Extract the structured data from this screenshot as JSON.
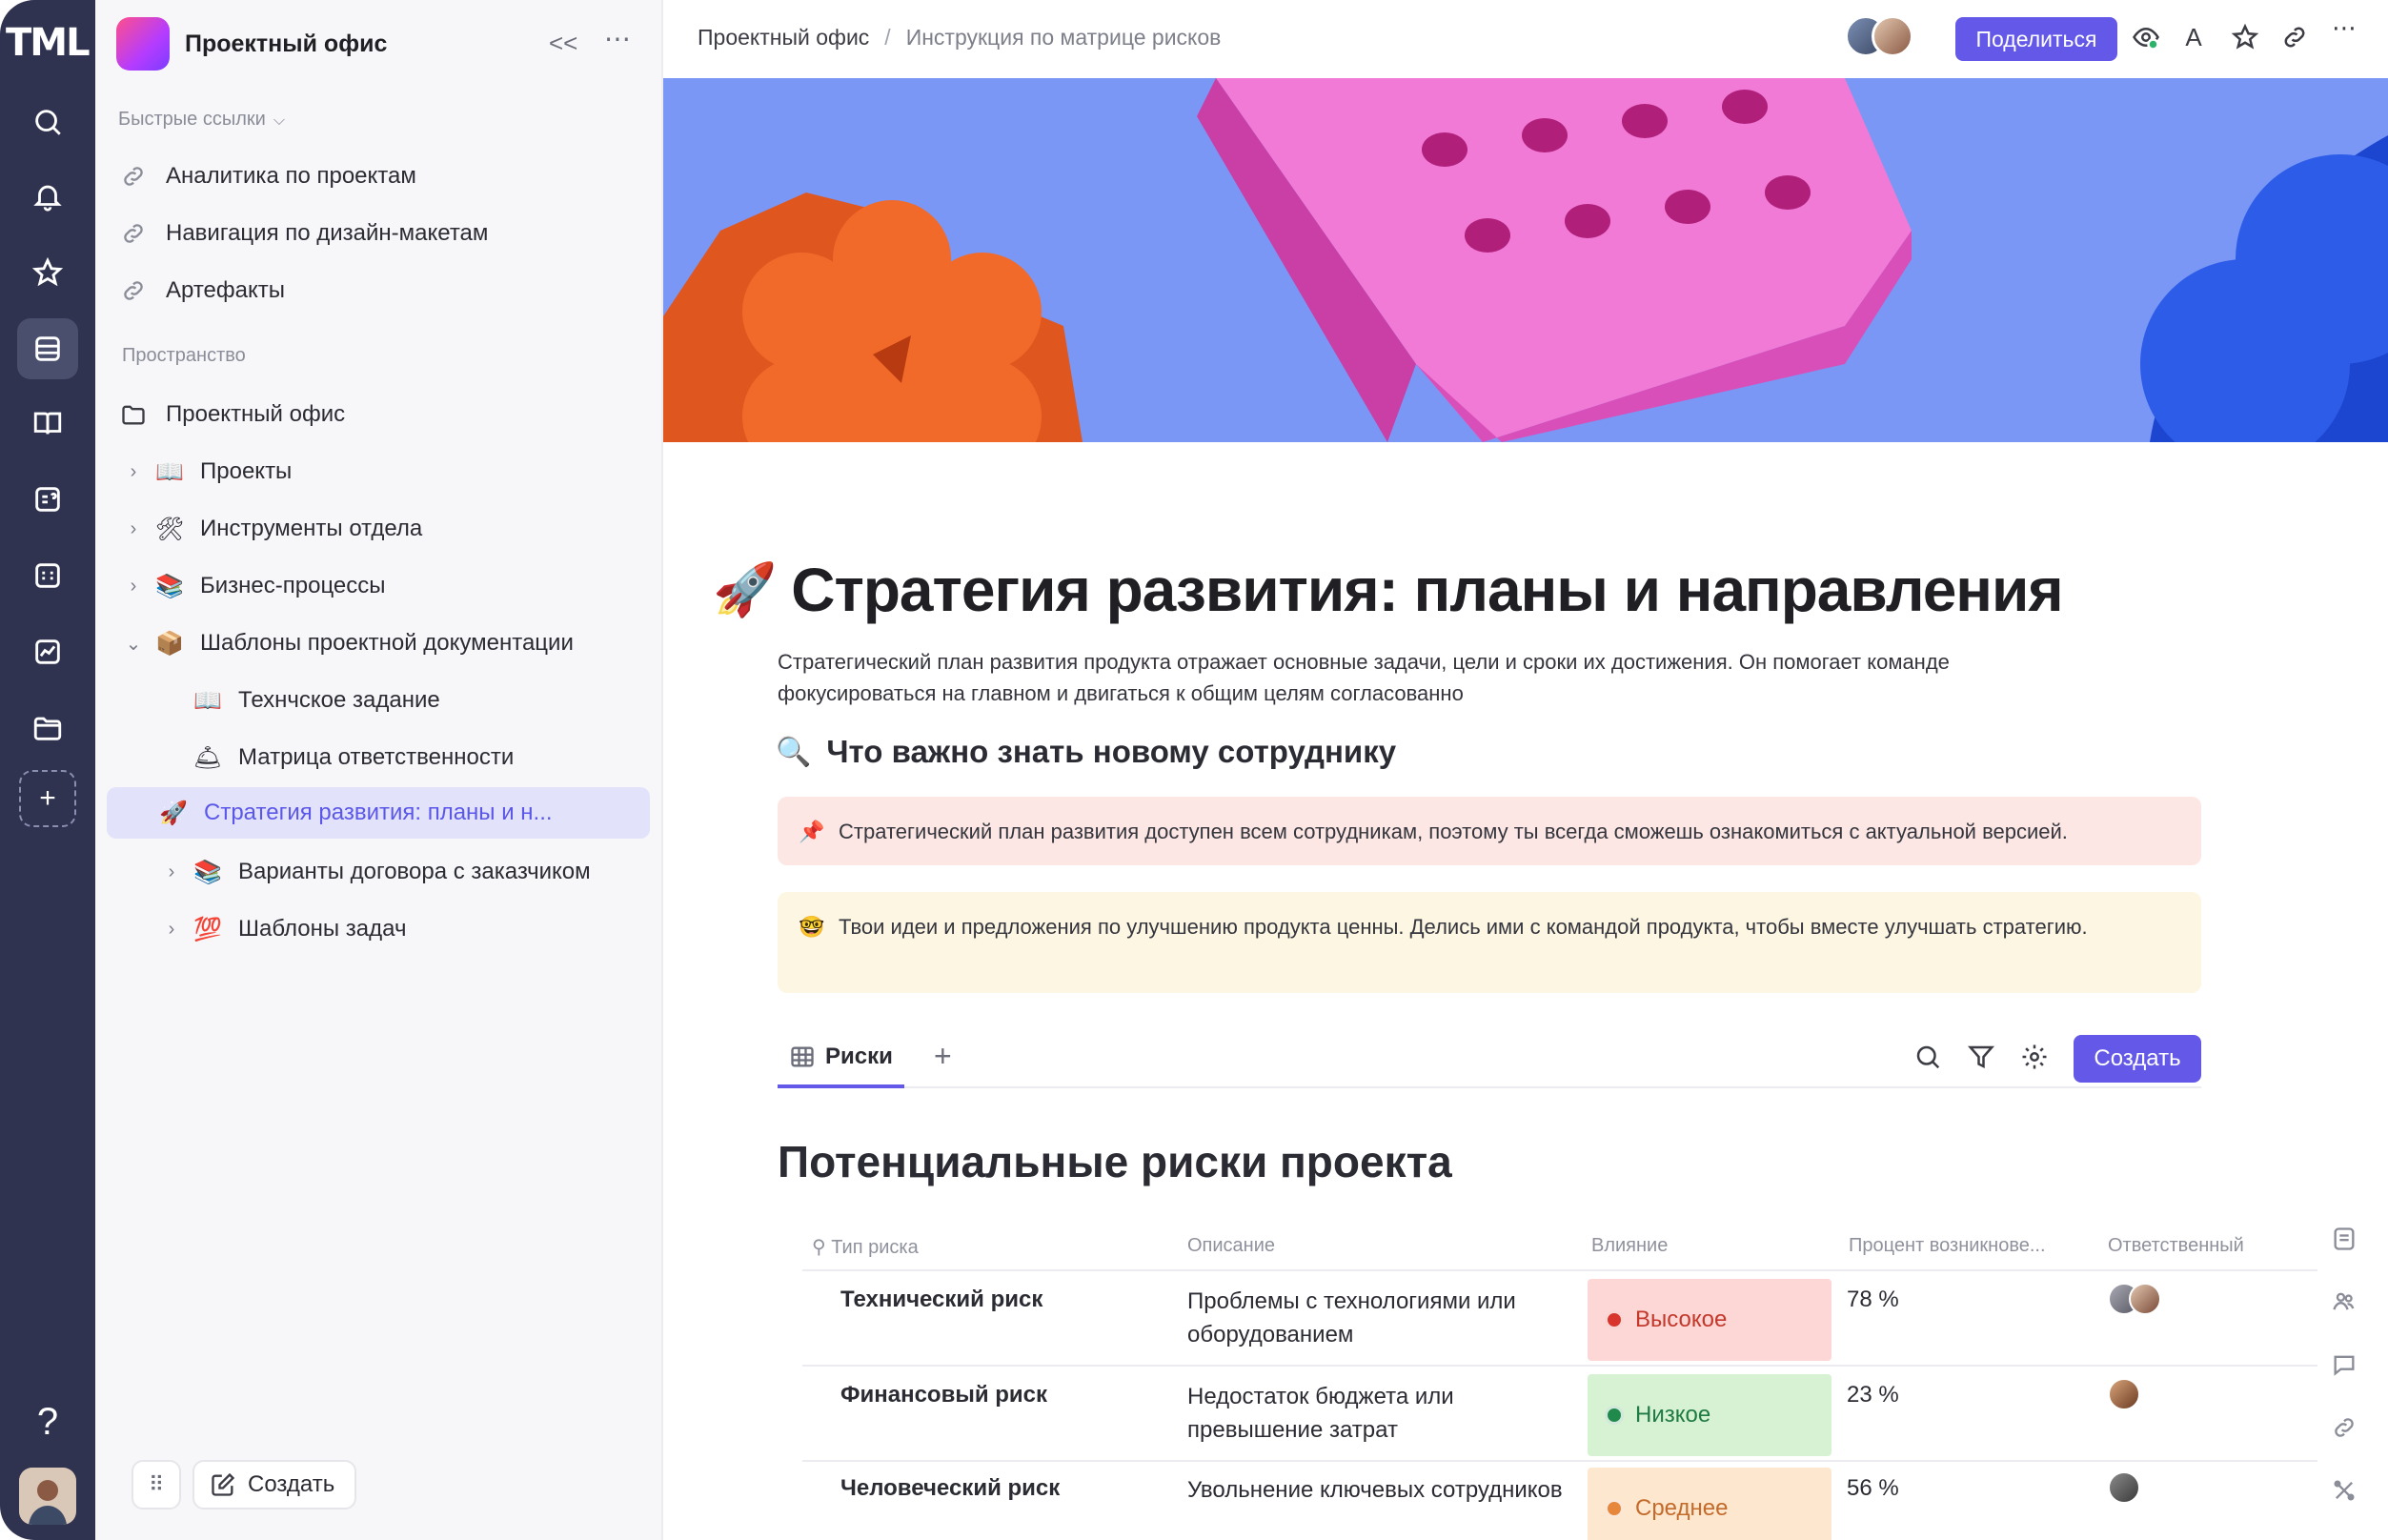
{
  "rail": {
    "logo": "TML",
    "icons": [
      "search-icon",
      "bell-icon",
      "star-icon",
      "docs-icon",
      "book-icon",
      "wiki-icon",
      "table-icon",
      "chart-icon",
      "folder-icon"
    ],
    "add": "+",
    "help": "?"
  },
  "sidebar": {
    "workspace_title": "Проектный офис",
    "collapse": "<<",
    "more": "⋯",
    "quick_links_label": "Быстрые ссылки",
    "quick_links": [
      {
        "label": "Аналитика по проектам"
      },
      {
        "label": "Навигация по дизайн-макетам"
      },
      {
        "label": "Артефакты"
      }
    ],
    "space_label": "Пространство",
    "tree": [
      {
        "label": "Проектный офис",
        "icon": "🗀"
      },
      {
        "label": "Проекты",
        "icon": "📖"
      },
      {
        "label": "Инструменты отдела",
        "icon": "🛠"
      },
      {
        "label": "Бизнес-процессы",
        "icon": "📚"
      },
      {
        "label": "Шаблоны проектной документации",
        "icon": "📦"
      },
      {
        "label": "Технчское задание",
        "icon": "📖"
      },
      {
        "label": "Матрица ответственности",
        "icon": "🛎"
      },
      {
        "label": "Стратегия развития: планы и н...",
        "icon": "🚀"
      },
      {
        "label": "Варианты договора с заказчиком",
        "icon": "📚"
      },
      {
        "label": "Шаблоны задач",
        "icon": "💯"
      }
    ],
    "create_label": "Создать"
  },
  "topbar": {
    "crumb_1": "Проектный офис",
    "crumb_sep": "/",
    "crumb_2": "Инструкция по матрице рисков",
    "share_label": "Поделиться",
    "font_icon": "A",
    "more": "⋯"
  },
  "page": {
    "title_emoji": "🚀",
    "title": "Стратегия развития: планы и направления",
    "lead": "Стратегический план развития продукта отражает основные задачи, цели и сроки их достижения. Он помогает команде фокусироваться на главном и двигаться к общим целям согласованно",
    "h2_emoji": "🔍",
    "h2": "Что важно знать новому сотруднику",
    "callout_red_emoji": "📌",
    "callout_red": "Стратегический план развития доступен всем сотрудникам, поэтому ты всегда сможешь ознакомиться с актуальной версией.",
    "callout_yellow_emoji": "🤓",
    "callout_yellow": "Твои идеи и предложения по улучшению продукта ценны. Делись ими с командой продукта, чтобы вместе улучшать стратегию.",
    "tab_label": "Риски",
    "tab_add": "+",
    "create_label": "Создать",
    "table_title": "Потенциальные риски проекта",
    "columns": [
      "Тип риска",
      "Описание",
      "Влияние",
      "Процент возникнове...",
      "Ответственный"
    ],
    "rows": [
      {
        "type": "Технический риск",
        "desc": "Проблемы с технологиями или оборудованием",
        "impact": "Высокое",
        "impact_bg": "#fcd7d6",
        "impact_dot": "#d8352c",
        "impact_color": "#c4372b",
        "percent": "78 %",
        "owners": 2
      },
      {
        "type": "Финансовый риск",
        "desc": "Недостаток бюджета или превышение затрат",
        "impact": "Низкое",
        "impact_bg": "#d6f2d2",
        "impact_dot": "#1f8a4c",
        "impact_color": "#1f7a44",
        "percent": "23 %",
        "owners": 1
      },
      {
        "type": "Человеческий риск",
        "desc": "Увольнение ключевых сотрудников",
        "impact": "Среднее",
        "impact_bg": "#fde8cf",
        "impact_dot": "#e7873b",
        "impact_color": "#c46a2a",
        "percent": "56 %",
        "owners": 1
      }
    ]
  },
  "colors": {
    "accent": "#6458e8",
    "rail": "#2f3350",
    "banner": "#7a97f5",
    "pink_block": "#f07ad6",
    "orange_flower": "#f26a2a",
    "blue_shape": "#2c5ce8"
  }
}
